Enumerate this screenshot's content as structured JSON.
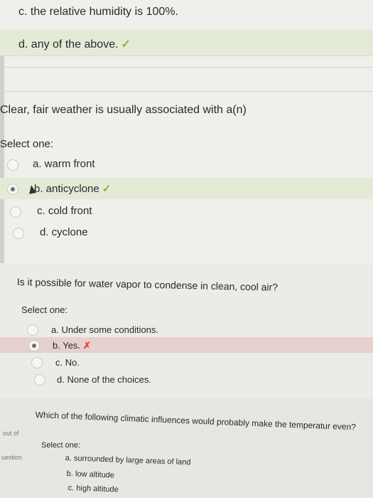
{
  "question_prev": {
    "options": [
      {
        "text": "c. the relative humidity is 100%."
      },
      {
        "text": "d. any of the above.",
        "mark": "✓"
      }
    ]
  },
  "question_fronts": {
    "text": "Clear, fair weather is usually associated with a(n)",
    "select_label": "Select one:",
    "options": [
      {
        "text": "a. warm front"
      },
      {
        "text": "b. anticyclone",
        "mark": "✓"
      },
      {
        "text": "c. cold front"
      },
      {
        "text": "d. cyclone"
      }
    ]
  },
  "question_vapor": {
    "text": "Is it possible for water vapor to condense in clean, cool air?",
    "select_label": "Select one:",
    "options": [
      {
        "text": "a. Under some conditions."
      },
      {
        "text": "b. Yes.",
        "mark": "✗"
      },
      {
        "text": "c. No."
      },
      {
        "text": "d. None of the choices."
      }
    ]
  },
  "question_climate": {
    "text": "Which of the following climatic influences would probably make the temperatur even?",
    "select_label": "Select one:",
    "options": [
      {
        "text": "a. surrounded by large areas of land"
      },
      {
        "text": "b. low altitude"
      },
      {
        "text": "c. high altitude"
      }
    ],
    "side_labels": [
      "out of",
      "uestion"
    ]
  },
  "colors": {
    "correct": "#7fba3a",
    "wrong": "#e0433f",
    "correct_bg": "#e3ebd7",
    "wrong_bg": "#e6d1cf"
  }
}
